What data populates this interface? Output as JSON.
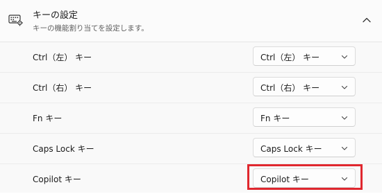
{
  "header": {
    "title": "キーの設定",
    "subtitle": "キーの機能割り当てを設定します。",
    "icon": "keyboard-settings-icon",
    "collapse_icon": "chevron-up-icon"
  },
  "rows": [
    {
      "label": "Ctrl（左） キー",
      "value": "Ctrl（左） キー"
    },
    {
      "label": "Ctrl（右） キー",
      "value": "Ctrl（右） キー"
    },
    {
      "label": "Fn キー",
      "value": "Fn キー"
    },
    {
      "label": "Caps Lock キー",
      "value": "Caps Lock キー"
    },
    {
      "label": "Copilot キー",
      "value": "Copilot キー"
    }
  ],
  "colors": {
    "highlight": "#e0272e",
    "background": "#f9f9f9"
  }
}
